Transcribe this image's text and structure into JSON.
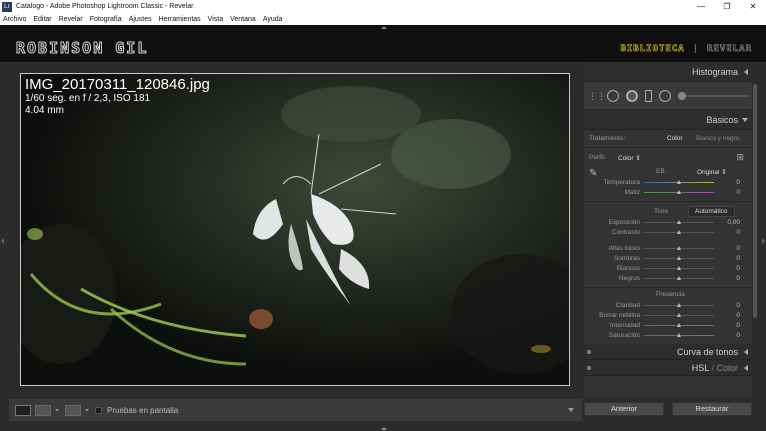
{
  "window": {
    "title": "Catalogo - Adobe Photoshop Lightroom Classic - Revelar",
    "app_badge": "Lr",
    "minimize": "—",
    "maximize": "❐",
    "close": "✕"
  },
  "menu": [
    "Archivo",
    "Editar",
    "Revelar",
    "Fotografía",
    "Ajustes",
    "Herramientas",
    "Vista",
    "Ventana",
    "Ayuda"
  ],
  "identity": {
    "plate": "ROBINSON GIL",
    "module_active": "BIBLIOTECA",
    "module_sep": "|",
    "module_inactive": "REVELAR"
  },
  "photo": {
    "filename": "IMG_20170311_120846.jpg",
    "exposure": "1/60 seg. en f / 2,3, ISO 181",
    "focal": "4.04 mm"
  },
  "toolbar": {
    "proof_label": "Pruebas en pantalla"
  },
  "panel": {
    "histogram": "Histograma",
    "basics": "Básicos",
    "treatment_label": "Tratamiento:",
    "treatment_color": "Color",
    "treatment_bw": "Blanco y negro",
    "profile_label": "Perfil:",
    "profile_value": "Color ⇕",
    "wb_label": "EB:",
    "wb_value": "Original ⇕",
    "wb_sliders": [
      {
        "label": "Temperatura",
        "value": "0"
      },
      {
        "label": "Matiz",
        "value": "0"
      }
    ],
    "tone_label": "Tono",
    "auto_label": "Automático",
    "tone_sliders_a": [
      {
        "label": "Exposición",
        "value": "0,00"
      },
      {
        "label": "Contraste",
        "value": "0"
      }
    ],
    "tone_sliders_b": [
      {
        "label": "Altas luces",
        "value": "0"
      },
      {
        "label": "Sombras",
        "value": "0"
      },
      {
        "label": "Blancos",
        "value": "0"
      },
      {
        "label": "Negros",
        "value": "0"
      }
    ],
    "presence_label": "Presencia",
    "presence_sliders": [
      {
        "label": "Claridad",
        "value": "0"
      },
      {
        "label": "Borrar neblina",
        "value": "0"
      },
      {
        "label": "Intensidad",
        "value": "0"
      },
      {
        "label": "Saturación",
        "value": "0"
      }
    ],
    "tone_curve": "Curva de tonos",
    "hsl": "HSL",
    "hsl_sep": "/",
    "hsl_color": "Color"
  },
  "buttons": {
    "previous": "Anterior",
    "reset": "Restaurar"
  },
  "colors": {
    "accent_module": "#d9d22f",
    "panel_bg": "#333333",
    "app_bg": "#2b2b2b"
  }
}
